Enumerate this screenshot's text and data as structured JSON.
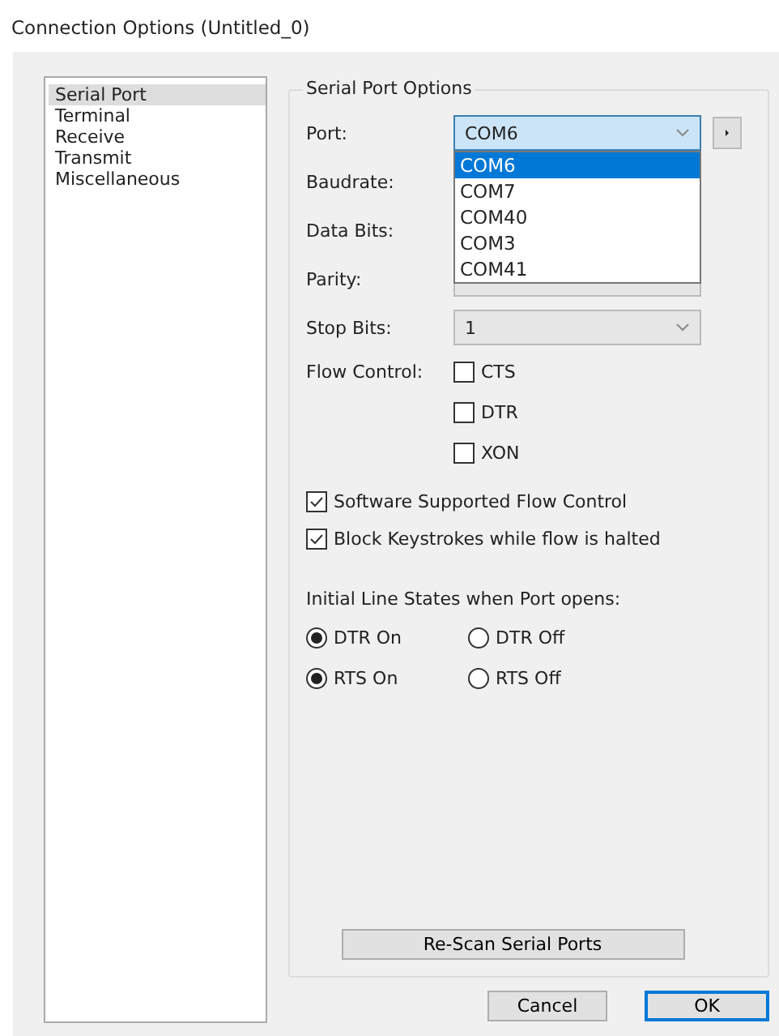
{
  "window": {
    "title": "Connection Options (Untitled_0)"
  },
  "sidebar": {
    "items": [
      {
        "label": "Serial Port",
        "selected": true
      },
      {
        "label": "Terminal",
        "selected": false
      },
      {
        "label": "Receive",
        "selected": false
      },
      {
        "label": "Transmit",
        "selected": false
      },
      {
        "label": "Miscellaneous",
        "selected": false
      }
    ]
  },
  "group": {
    "title": "Serial Port Options",
    "port": {
      "label": "Port:",
      "value": "COM6",
      "options": [
        {
          "label": "COM6",
          "selected": true
        },
        {
          "label": "COM7",
          "selected": false
        },
        {
          "label": "COM40",
          "selected": false
        },
        {
          "label": "COM3",
          "selected": false
        },
        {
          "label": "COM41",
          "selected": false
        }
      ]
    },
    "fields": [
      {
        "label": "Baudrate:",
        "kind": "label"
      },
      {
        "label": "Data Bits:",
        "kind": "label"
      },
      {
        "label": "Parity:",
        "kind": "dropdown"
      },
      {
        "label": "Stop Bits:",
        "kind": "dropdown",
        "value": "1"
      }
    ],
    "flow_control": {
      "label": "Flow Control:",
      "options": [
        {
          "label": "CTS",
          "checked": false
        },
        {
          "label": "DTR",
          "checked": false
        },
        {
          "label": "XON",
          "checked": false
        }
      ]
    },
    "checkboxes": [
      {
        "label": "Software Supported Flow Control",
        "checked": true
      },
      {
        "label": "Block Keystrokes while flow is halted",
        "checked": true
      }
    ],
    "line_states": {
      "label": "Initial Line States when Port opens:",
      "rows": [
        [
          {
            "label": "DTR On",
            "selected": true
          },
          {
            "label": "DTR Off",
            "selected": false
          }
        ],
        [
          {
            "label": "RTS On",
            "selected": true
          },
          {
            "label": "RTS Off",
            "selected": false
          }
        ]
      ]
    },
    "rescan_button": "Re-Scan Serial Ports"
  },
  "buttons": [
    {
      "label": "Cancel",
      "default": false
    },
    {
      "label": "OK",
      "default": true
    }
  ]
}
